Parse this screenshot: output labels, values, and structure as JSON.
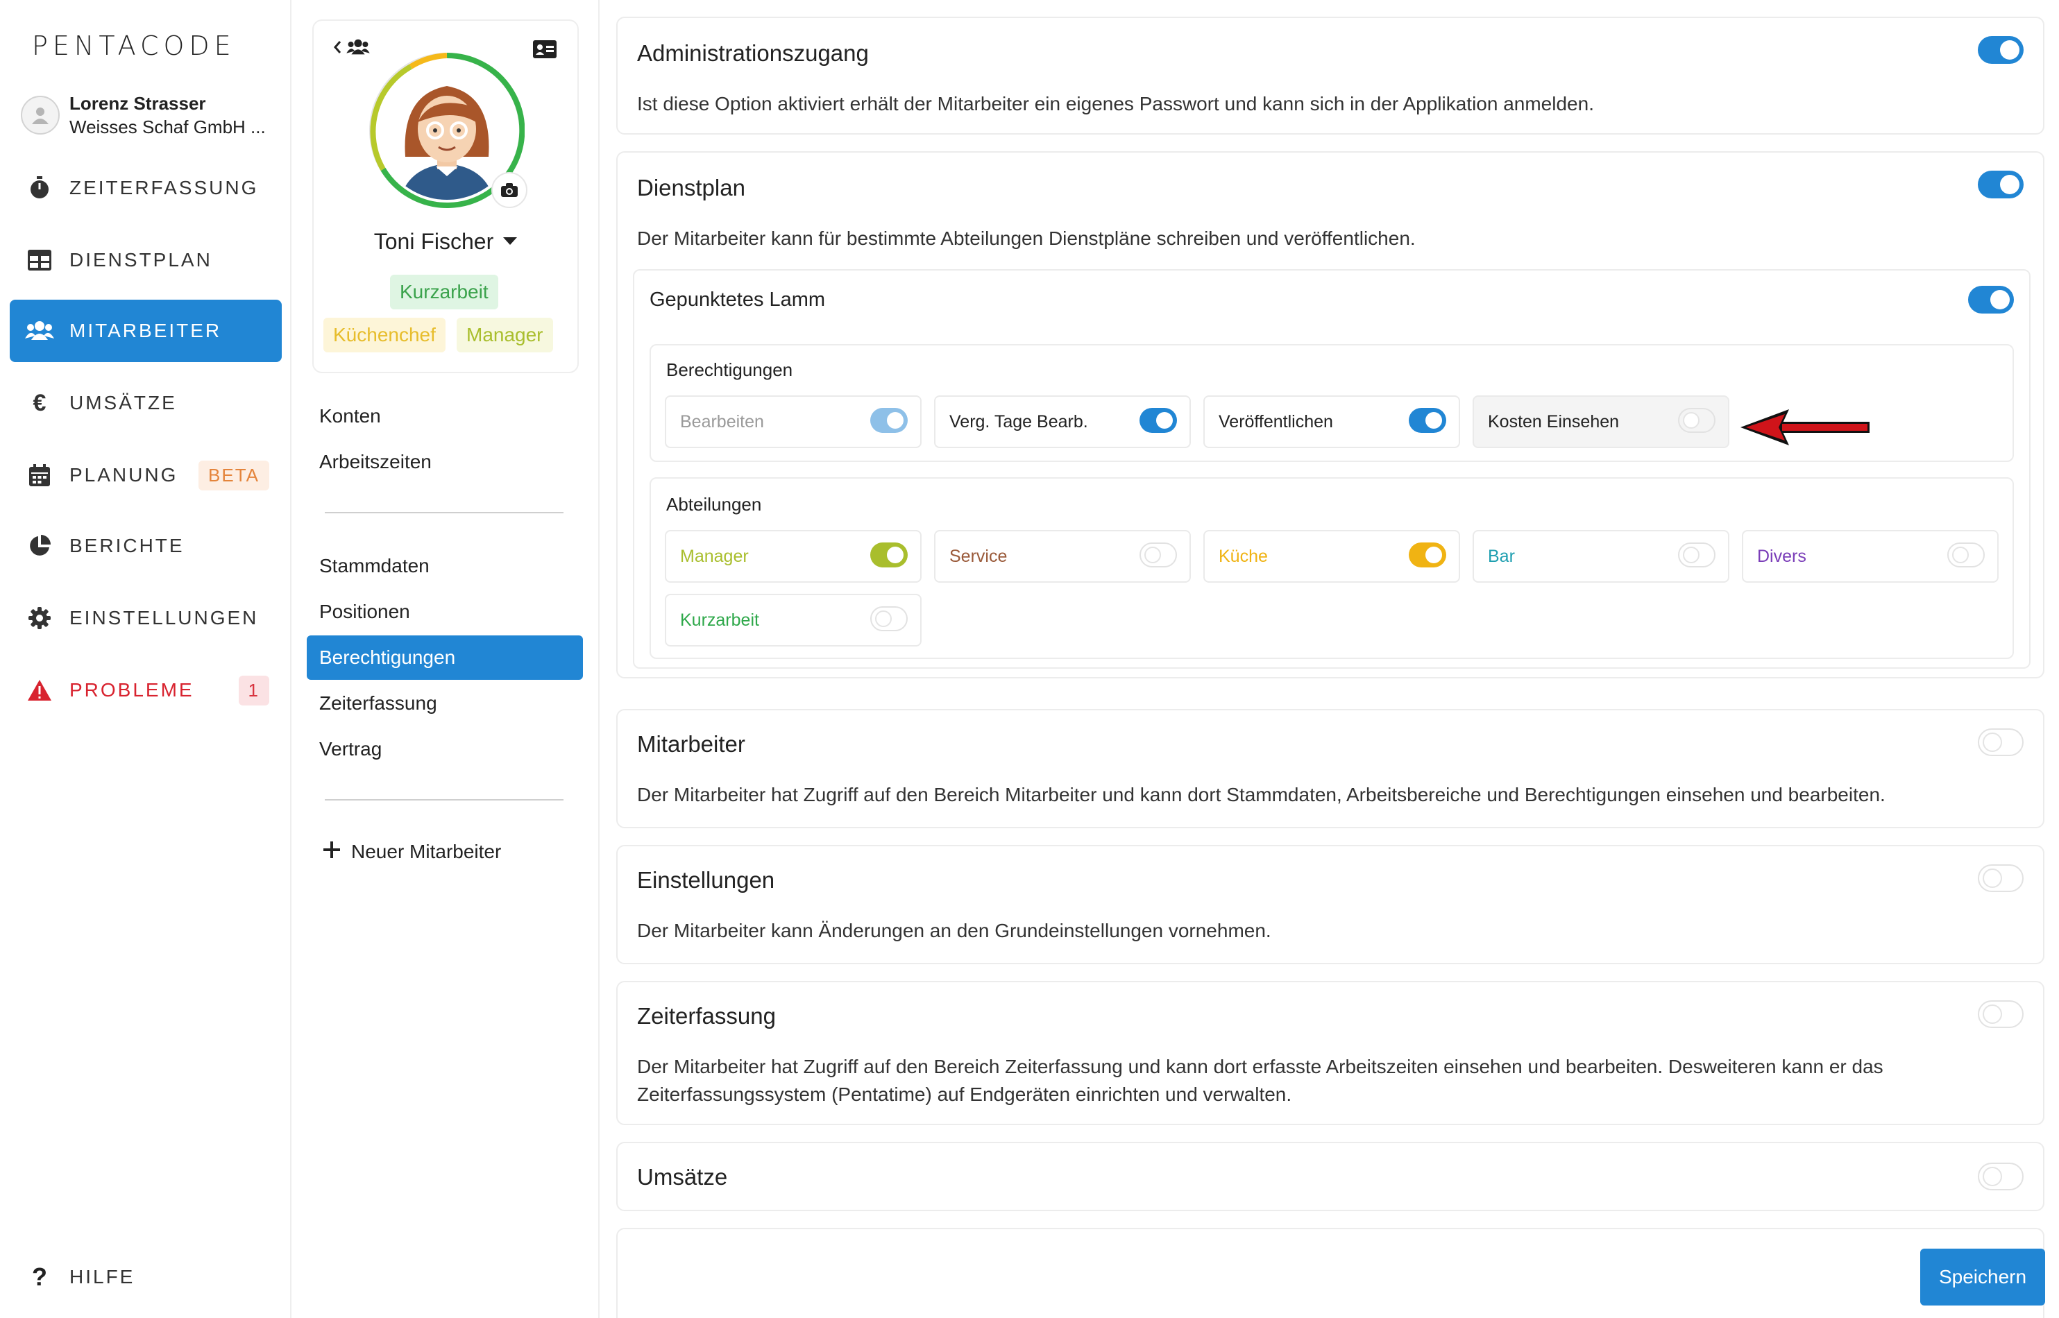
{
  "app": {
    "logo": "PENTACODE"
  },
  "user": {
    "name": "Lorenz Strasser",
    "company": "Weisses Schaf GmbH ..."
  },
  "nav": {
    "items": [
      {
        "label": "ZEITERFASSUNG",
        "icon": "stopwatch-icon"
      },
      {
        "label": "DIENSTPLAN",
        "icon": "table-icon"
      },
      {
        "label": "MITARBEITER",
        "icon": "users-icon",
        "active": true
      },
      {
        "label": "UMSÄTZE",
        "icon": "euro-icon"
      },
      {
        "label": "PLANUNG",
        "icon": "calendar-icon",
        "badge": "BETA"
      },
      {
        "label": "BERICHTE",
        "icon": "pie-chart-icon"
      },
      {
        "label": "EINSTELLUNGEN",
        "icon": "gear-icon"
      },
      {
        "label": "PROBLEME",
        "icon": "warning-icon",
        "badge": "1"
      }
    ],
    "help": "HILFE"
  },
  "profile": {
    "name": "Toni Fischer",
    "tags": [
      "Kurzarbeit",
      "Küchenchef",
      "Manager"
    ]
  },
  "subnav": {
    "group1": [
      "Konten",
      "Arbeitszeiten"
    ],
    "group2": [
      "Stammdaten",
      "Positionen",
      "Berechtigungen",
      "Zeiterfassung",
      "Vertrag"
    ],
    "new_employee": "Neuer Mitarbeiter"
  },
  "permissions": {
    "admin": {
      "title": "Administrationszugang",
      "desc": "Ist diese Option aktiviert erhält der Mitarbeiter ein eigenes Passwort und kann sich in der Applikation anmelden.",
      "enabled": true
    },
    "dienstplan": {
      "title": "Dienstplan",
      "desc": "Der Mitarbeiter kann für bestimmte Abteilungen Dienstpläne schreiben und veröffentlichen.",
      "enabled": true,
      "location": {
        "name": "Gepunktetes Lamm",
        "enabled": true,
        "rights_label": "Berechtigungen",
        "rights": [
          {
            "label": "Bearbeiten",
            "on": true,
            "disabled": true
          },
          {
            "label": "Verg. Tage Bearb.",
            "on": true
          },
          {
            "label": "Veröffentlichen",
            "on": true
          },
          {
            "label": "Kosten Einsehen",
            "on": false
          }
        ],
        "departments_label": "Abteilungen",
        "departments": [
          {
            "label": "Manager",
            "on": true,
            "color": "#a9be2d"
          },
          {
            "label": "Service",
            "on": false,
            "color": "#9a5a3a"
          },
          {
            "label": "Küche",
            "on": true,
            "color": "#f0b313"
          },
          {
            "label": "Bar",
            "on": false,
            "color": "#1f9fb0"
          },
          {
            "label": "Divers",
            "on": false,
            "color": "#7a3db8"
          },
          {
            "label": "Kurzarbeit",
            "on": false,
            "color": "#2ea84a"
          }
        ]
      }
    },
    "mitarbeiter": {
      "title": "Mitarbeiter",
      "desc": "Der Mitarbeiter hat Zugriff auf den Bereich Mitarbeiter und kann dort Stammdaten, Arbeitsbereiche und Berechtigungen einsehen und bearbeiten.",
      "enabled": false
    },
    "einstellungen": {
      "title": "Einstellungen",
      "desc": "Der Mitarbeiter kann Änderungen an den Grundeinstellungen vornehmen.",
      "enabled": false
    },
    "zeiterfassung": {
      "title": "Zeiterfassung",
      "desc": "Der Mitarbeiter hat Zugriff auf den Bereich Zeiterfassung und kann dort erfasste Arbeitszeiten einsehen und bearbeiten. Desweiteren kann er das Zeiterfassungssystem (Pentatime) auf Endgeräten einrichten und verwalten.",
      "enabled": false
    },
    "umsaetze": {
      "title": "Umsätze",
      "enabled": false
    }
  },
  "actions": {
    "save": "Speichern"
  },
  "colors": {
    "accent": "#2186d4",
    "problem": "#d8232f",
    "arrow": "#d0141a"
  }
}
